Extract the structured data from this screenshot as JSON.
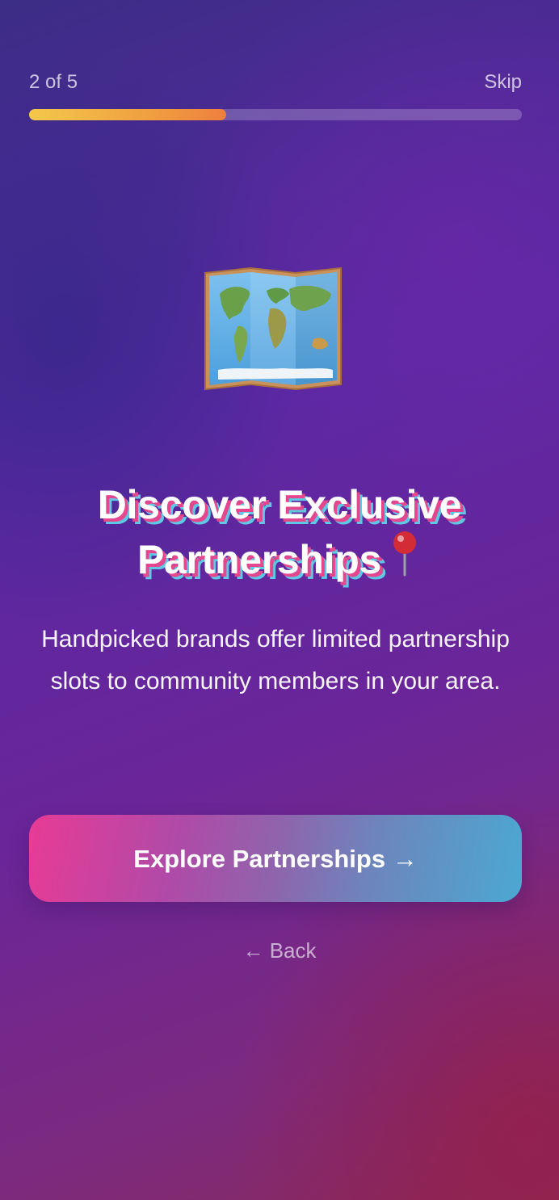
{
  "onboarding": {
    "step_label": "2 of 5",
    "step_current": 2,
    "step_total": 5,
    "skip_label": "Skip",
    "progress_fraction": 0.4,
    "hero_icon": "world-map-icon",
    "title_text": "Discover Exclusive Partnerships",
    "title_icon": "round-pushpin-icon",
    "subtitle": "Handpicked brands offer limited partnership slots to community members in your area.",
    "cta_label": "Explore Partnerships →",
    "back_label": "← Back"
  },
  "colors": {
    "progress_start": "#f3c84b",
    "progress_end": "#ee7f3e",
    "cta_start": "#e83b95",
    "cta_end": "#4ba8d2",
    "title_shadow_pink": "#e4478e",
    "title_shadow_cyan": "#5fc8e4"
  }
}
